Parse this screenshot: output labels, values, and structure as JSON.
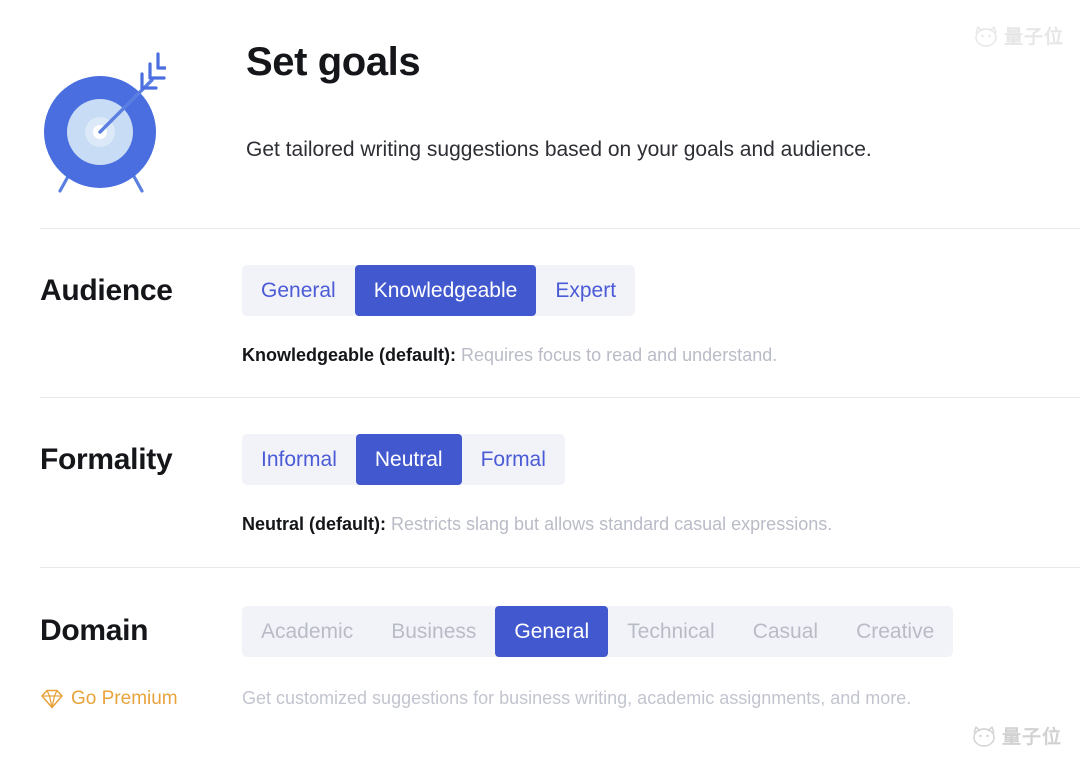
{
  "header": {
    "title": "Set goals",
    "subtitle": "Get tailored writing suggestions based on your goals and audience.",
    "icon": "target-arrow-icon"
  },
  "sections": [
    {
      "id": "audience",
      "label": "Audience",
      "options": [
        {
          "label": "General",
          "selected": false,
          "locked": false
        },
        {
          "label": "Knowledgeable",
          "selected": true,
          "locked": false
        },
        {
          "label": "Expert",
          "selected": false,
          "locked": false
        }
      ],
      "desc_strong": "Knowledgeable (default):",
      "desc_text": " Requires focus to read and understand."
    },
    {
      "id": "formality",
      "label": "Formality",
      "options": [
        {
          "label": "Informal",
          "selected": false,
          "locked": false
        },
        {
          "label": "Neutral",
          "selected": true,
          "locked": false
        },
        {
          "label": "Formal",
          "selected": false,
          "locked": false
        }
      ],
      "desc_strong": "Neutral (default):",
      "desc_text": " Restricts slang but allows standard casual expressions."
    },
    {
      "id": "domain",
      "label": "Domain",
      "options": [
        {
          "label": "Academic",
          "selected": false,
          "locked": true
        },
        {
          "label": "Business",
          "selected": false,
          "locked": true
        },
        {
          "label": "General",
          "selected": true,
          "locked": false
        },
        {
          "label": "Technical",
          "selected": false,
          "locked": true
        },
        {
          "label": "Casual",
          "selected": false,
          "locked": true
        },
        {
          "label": "Creative",
          "selected": false,
          "locked": true
        }
      ],
      "desc_strong": "",
      "desc_text": ""
    }
  ],
  "premium": {
    "icon": "diamond-gem-icon",
    "label": "Go Premium",
    "description": "Get customized suggestions for business writing, academic assignments, and more."
  },
  "watermark": {
    "text": "量子位",
    "icon": "qbitai-cat-icon"
  },
  "colors": {
    "accent_selected": "#4258ce",
    "accent_label": "#4b5bd6",
    "segment_track": "#f2f3f9",
    "muted_text": "#b9bcc7",
    "title_text": "#14161a",
    "premium_gold": "#e8a33d",
    "divider": "#e8eaed"
  }
}
